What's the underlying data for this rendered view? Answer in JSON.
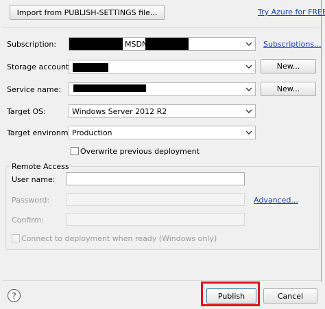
{
  "top": {
    "import_button": "Import from PUBLISH-SETTINGS file...",
    "try_azure_link": "Try Azure for FREE..."
  },
  "form": {
    "subscription": {
      "label": "Subscription:",
      "value_visible": "MSDN",
      "link": "Subscriptions..."
    },
    "storage_account": {
      "label": "Storage account:",
      "new_button": "New..."
    },
    "service_name": {
      "label": "Service name:",
      "new_button": "New..."
    },
    "target_os": {
      "label": "Target OS:",
      "value": "Windows Server 2012 R2"
    },
    "target_environment": {
      "label": "Target environment:",
      "value": "Production"
    },
    "overwrite": {
      "label": "Overwrite previous deployment",
      "checked": false
    }
  },
  "remote_access": {
    "title": "Remote Access",
    "user_name_label": "User name:",
    "user_name_value": "",
    "password_label": "Password:",
    "advanced_link": "Advanced...",
    "confirm_label": "Confirm:",
    "connect_label": "Connect to deployment when ready (Windows only)",
    "connect_checked": false
  },
  "footer": {
    "help_icon": "?",
    "publish_button": "Publish",
    "cancel_button": "Cancel",
    "highlight_color": "#e0141e"
  },
  "colors": {
    "background": "#f0f0f0",
    "link": "#1a3eb1",
    "disabled_text": "#9a9a9a"
  }
}
